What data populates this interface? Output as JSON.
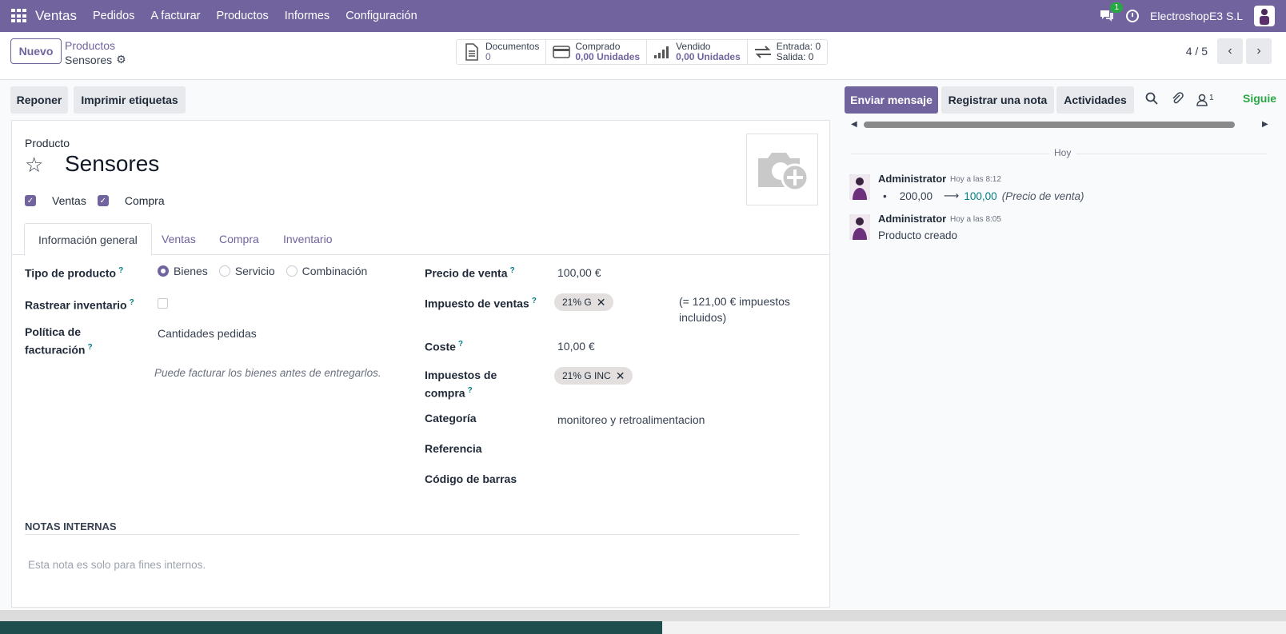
{
  "topbar": {
    "app_name": "Ventas",
    "menu": [
      "Pedidos",
      "A facturar",
      "Productos",
      "Informes",
      "Configuración"
    ],
    "chat_count": "1",
    "company": "ElectroshopE3 S.L"
  },
  "control": {
    "new_label": "Nuevo",
    "breadcrumb_parent": "Productos",
    "breadcrumb_current": "Sensores",
    "smart_buttons": [
      {
        "icon": "document-icon",
        "label": "Documentos",
        "value": "0"
      },
      {
        "icon": "credit-card-icon",
        "label": "Comprado",
        "value": "0,00 Unidades"
      },
      {
        "icon": "bar-chart-icon",
        "label": "Vendido",
        "value": "0,00 Unidades"
      },
      {
        "icon": "exchange-icon",
        "label": "Entrada: 0",
        "value": "Salida: 0"
      }
    ],
    "pager": "4 / 5"
  },
  "actions": {
    "reponer": "Reponer",
    "imprimir": "Imprimir etiquetas",
    "send_message": "Enviar mensaje",
    "log_note": "Registrar una nota",
    "activities": "Actividades",
    "followers_count": "1",
    "follow": "Siguie"
  },
  "form": {
    "product_label": "Producto",
    "name": "Sensores",
    "check_sales": "Ventas",
    "check_purchase": "Compra",
    "tabs": [
      "Información general",
      "Ventas",
      "Compra",
      "Inventario"
    ],
    "tipo_label": "Tipo de producto",
    "tipo_options": [
      "Bienes",
      "Servicio",
      "Combinación"
    ],
    "tipo_selected": "Bienes",
    "rastrear_label": "Rastrear inventario",
    "politica_label_1": "Política de",
    "politica_label_2": "facturación",
    "politica_value": "Cantidades pedidas",
    "politica_note": "Puede facturar los bienes antes de entregarlos.",
    "precio_label": "Precio de venta",
    "precio_value": "100,00 €",
    "impuesto_venta_label": "Impuesto de ventas",
    "impuesto_venta_tag": "21% G",
    "impuesto_venta_note_1": "(= 121,00 € impuestos",
    "impuesto_venta_note_2": "incluidos)",
    "coste_label": "Coste",
    "coste_value": "10,00 €",
    "impuesto_compra_label_1": "Impuestos de",
    "impuesto_compra_label_2": "compra",
    "impuesto_compra_tag": "21% G INC",
    "categoria_label": "Categoría",
    "categoria_value": "monitoreo y retroalimentacion",
    "referencia_label": "Referencia",
    "barcode_label": "Código de barras",
    "notes_title": "NOTAS INTERNAS",
    "notes_placeholder": "Esta nota es solo para fines internos."
  },
  "chatter": {
    "day": "Hoy",
    "messages": [
      {
        "author": "Administrator",
        "time": "Hoy a las 8:12",
        "old": "200,00",
        "new": "100,00",
        "field": "(Precio de venta)"
      },
      {
        "author": "Administrator",
        "time": "Hoy a las 8:05",
        "body": "Producto creado"
      }
    ]
  },
  "colors": {
    "brand": "#71639e",
    "follow": "#28a745",
    "link": "#017e84"
  }
}
